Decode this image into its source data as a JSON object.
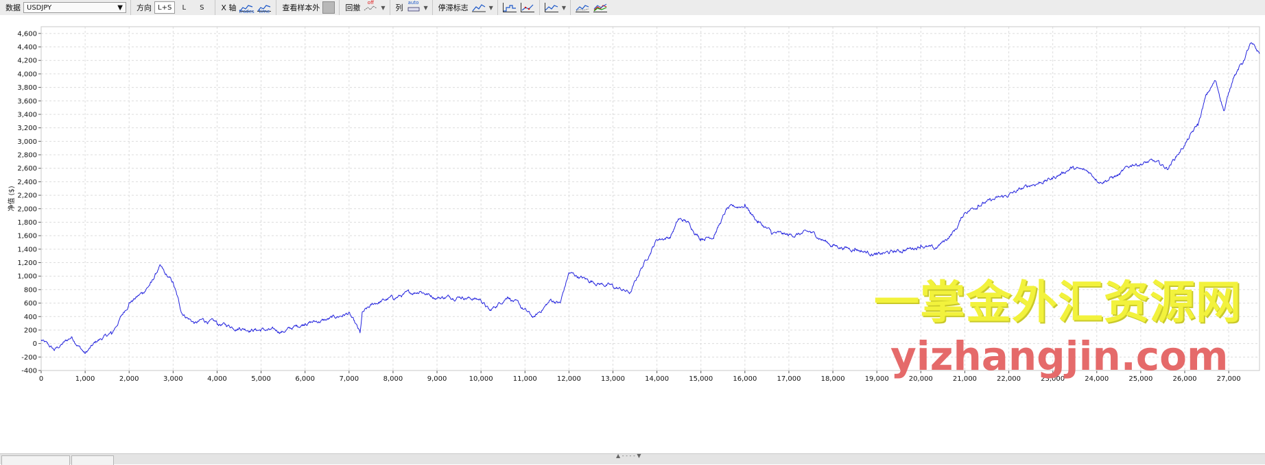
{
  "toolbar": {
    "data_label": "数据",
    "symbol": "USDJPY",
    "direction_label": "方向",
    "direction_options": [
      "L+S",
      "L",
      "S"
    ],
    "xaxis_label": "X 轴",
    "xaxis_options": [
      "trades",
      "time"
    ],
    "oos_label": "查看样本外",
    "drawdown_label": "回撤",
    "drawdown_state": "off",
    "columns_label": "列",
    "columns_state": "auto",
    "stop_label": "停滞标志"
  },
  "chart_data": {
    "type": "line",
    "title": "",
    "xlabel": "",
    "ylabel": "净值 ($)",
    "xlim": [
      0,
      27700
    ],
    "ylim": [
      -400,
      4700
    ],
    "x_ticks": [
      "0",
      "1,000",
      "2,000",
      "3,000",
      "4,000",
      "5,000",
      "6,000",
      "7,000",
      "8,000",
      "9,000",
      "10,000",
      "11,000",
      "12,000",
      "13,000",
      "14,000",
      "15,000",
      "16,000",
      "17,000",
      "18,000",
      "19,000",
      "20,000",
      "21,000",
      "22,000",
      "23,000",
      "24,000",
      "25,000",
      "26,000",
      "27,000"
    ],
    "y_ticks": [
      "-400",
      "-200",
      "0",
      "200",
      "400",
      "600",
      "800",
      "1,000",
      "1,200",
      "1,400",
      "1,600",
      "1,800",
      "2,000",
      "2,200",
      "2,400",
      "2,600",
      "2,800",
      "3,000",
      "3,200",
      "3,400",
      "3,600",
      "3,800",
      "4,000",
      "4,200",
      "4,400",
      "4,600"
    ],
    "grid": true,
    "series": [
      {
        "color": "#2222dd",
        "x": [
          0,
          300,
          700,
          1000,
          1300,
          1600,
          2000,
          2300,
          2500,
          2700,
          2800,
          3000,
          3200,
          3500,
          3700,
          4000,
          4500,
          5000,
          5500,
          6000,
          6500,
          7000,
          7250,
          7300,
          7600,
          8000,
          8600,
          9000,
          9500,
          10000,
          10200,
          10600,
          10900,
          11200,
          11600,
          11800,
          12000,
          12500,
          13000,
          13400,
          13600,
          14000,
          14300,
          14500,
          14700,
          15000,
          15300,
          15600,
          16000,
          16300,
          16600,
          17000,
          17500,
          18000,
          18500,
          19000,
          19600,
          20000,
          20300,
          20600,
          20800,
          21000,
          21300,
          21500,
          22000,
          22500,
          23000,
          23400,
          23800,
          24100,
          24500,
          24800,
          25300,
          25600,
          26000,
          26300,
          26500,
          26700,
          26900,
          27100,
          27300,
          27500,
          27700
        ],
        "y": [
          50,
          -100,
          100,
          -150,
          50,
          150,
          600,
          750,
          900,
          1150,
          1050,
          900,
          450,
          300,
          350,
          300,
          230,
          200,
          180,
          300,
          350,
          450,
          150,
          450,
          600,
          680,
          780,
          680,
          700,
          650,
          480,
          700,
          550,
          380,
          650,
          600,
          1050,
          920,
          850,
          750,
          1050,
          1550,
          1580,
          1850,
          1800,
          1550,
          1600,
          2000,
          2050,
          1800,
          1650,
          1600,
          1650,
          1450,
          1400,
          1320,
          1380,
          1450,
          1400,
          1550,
          1700,
          1950,
          2050,
          2100,
          2200,
          2350,
          2450,
          2600,
          2550,
          2400,
          2500,
          2650,
          2700,
          2600,
          2950,
          3250,
          3700,
          3900,
          3450,
          3950,
          4150,
          4450,
          4300
        ]
      }
    ]
  },
  "watermark": {
    "cn": "一掌金外汇资源网",
    "en": "yizhangjin.com"
  }
}
